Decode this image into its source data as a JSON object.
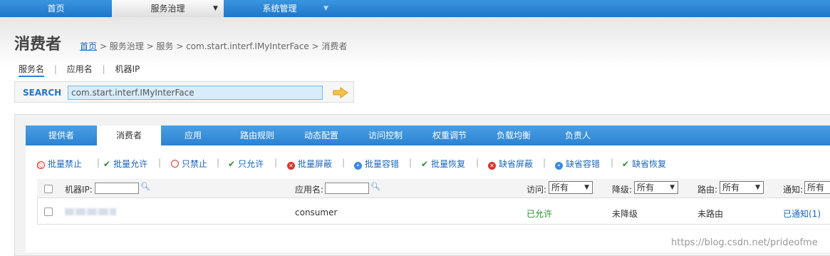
{
  "topnav": {
    "home": "首页",
    "service_gov": "服务治理",
    "system_mgmt": "系统管理"
  },
  "page": {
    "title": "消费者",
    "breadcrumb": {
      "home": "首页",
      "rest": "> 服务治理 > 服务 > com.start.interf.IMyInterFace > 消费者"
    }
  },
  "search_tabs": [
    "服务名",
    "应用名",
    "机器IP"
  ],
  "search": {
    "label": "SEARCH",
    "value": "com.start.interf.IMyInterFace"
  },
  "tabs": [
    "提供者",
    "消费者",
    "应用",
    "路由规则",
    "动态配置",
    "访问控制",
    "权重调节",
    "负载均衡",
    "负责人"
  ],
  "actions": [
    "批量禁止",
    "批量允许",
    "只禁止",
    "只允许",
    "批量屏蔽",
    "批量容错",
    "批量恢复",
    "缺省屏蔽",
    "缺省容错",
    "缺省恢复"
  ],
  "table": {
    "headers": {
      "ip": "机器IP:",
      "app": "应用名:",
      "access": "访问:",
      "degrade": "降级:",
      "route": "路由:",
      "notify": "通知:"
    },
    "filters": {
      "access": "所有",
      "degrade": "所有",
      "route": "所有",
      "notify": "所有"
    },
    "rows": [
      {
        "app": "consumer",
        "access": "已允许",
        "degrade": "未降级",
        "route": "未路由",
        "notify": "已通知(1)"
      }
    ]
  },
  "watermark": "https://blog.csdn.net/prideofme",
  "colors": {
    "nav_blue": "#2b82d2",
    "link_blue": "#1b67b8",
    "allow_green": "#2e8b2e",
    "deny_red": "#d9342b"
  }
}
